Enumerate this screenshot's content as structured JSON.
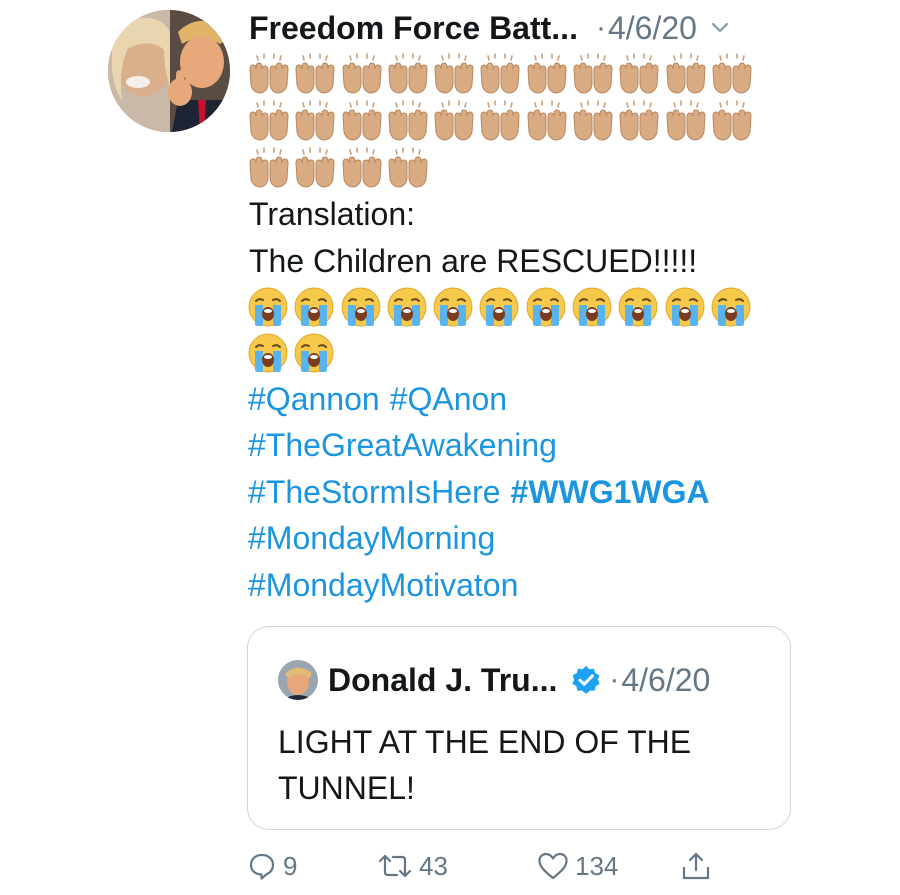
{
  "tweet": {
    "author_name": "Freedom Force Batt...",
    "date": "4/6/20",
    "date_separator": "·",
    "emoji": {
      "raised_hands_count": 26,
      "crying_face_count": 13
    },
    "text_lines": [
      "Translation:",
      "The Children are RESCUED!!!!!"
    ],
    "hashtag_lines": [
      [
        {
          "text": "#Qannon",
          "bold": false
        },
        {
          "text": "#QAnon",
          "bold": false
        }
      ],
      [
        {
          "text": "#TheGreatAwakening",
          "bold": false
        }
      ],
      [
        {
          "text": "#TheStormIsHere",
          "bold": false
        },
        {
          "text": "#WWG1WGA",
          "bold": true
        }
      ],
      [
        {
          "text": "#MondayMorning",
          "bold": false
        }
      ],
      [
        {
          "text": "#MondayMotivaton",
          "bold": false
        }
      ]
    ]
  },
  "quoted_tweet": {
    "author_name": "Donald J. Tru...",
    "date_separator": "·",
    "date": "4/6/20",
    "text": "LIGHT AT THE END OF THE TUNNEL!"
  },
  "actions": {
    "reply_count": "9",
    "retweet_count": "43",
    "like_count": "134"
  },
  "colors": {
    "text": "#14171a",
    "secondary": "#657786",
    "link": "#1b95e0",
    "verified": "#1da1f2",
    "border": "#ccd6dd"
  },
  "icons": [
    "chevron-down-icon",
    "verified-badge-icon",
    "reply-icon",
    "retweet-icon",
    "like-icon",
    "share-icon",
    "raised-hands-emoji",
    "loudly-crying-face-emoji"
  ]
}
